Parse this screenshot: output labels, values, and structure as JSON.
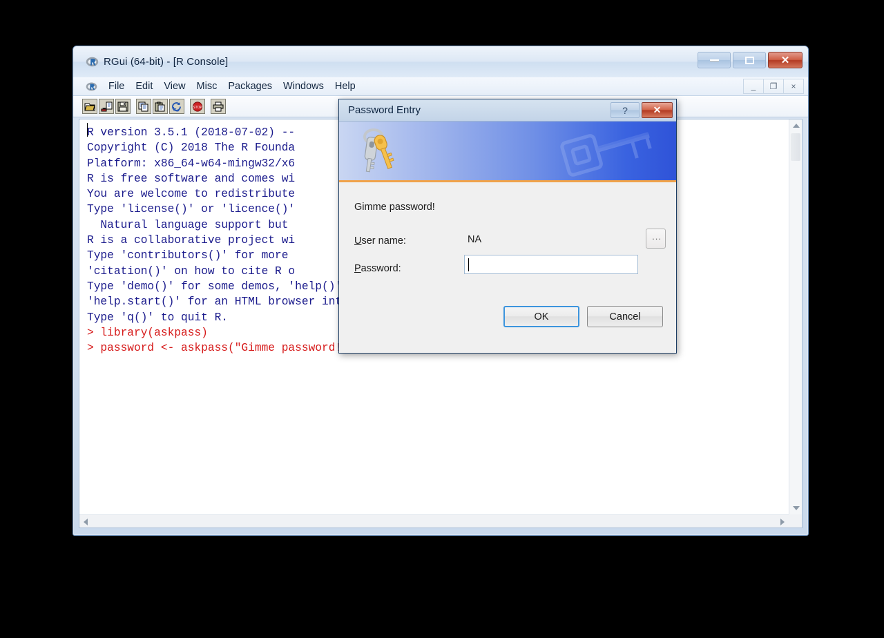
{
  "window": {
    "title": "RGui (64-bit) - [R Console]",
    "logo_icon": "r-logo-icon",
    "buttons": {
      "minimize": {
        "label": "–",
        "icon": "minimize-icon"
      },
      "maximize": {
        "label": "□",
        "icon": "maximize-icon"
      },
      "close": {
        "label": "✕",
        "icon": "close-icon"
      }
    },
    "mdi_buttons": {
      "minimize": "_",
      "restore": "❐",
      "close": "×"
    }
  },
  "menubar": {
    "items": [
      {
        "label": "File"
      },
      {
        "label": "Edit"
      },
      {
        "label": "View"
      },
      {
        "label": "Misc"
      },
      {
        "label": "Packages"
      },
      {
        "label": "Windows"
      },
      {
        "label": "Help"
      }
    ]
  },
  "toolbar": {
    "buttons": [
      {
        "name": "open-script-icon"
      },
      {
        "name": "load-workspace-icon"
      },
      {
        "name": "save-workspace-icon"
      },
      {
        "name": "copy-icon"
      },
      {
        "name": "paste-icon"
      },
      {
        "name": "copy-paste-icon"
      },
      {
        "name": "stop-icon"
      },
      {
        "name": "print-icon"
      }
    ]
  },
  "console": {
    "text_color": "#1a1a8c",
    "command_color": "#d61a1a",
    "lines": [
      {
        "text": "",
        "type": "out"
      },
      {
        "text": "R version 3.5.1 (2018-07-02) --",
        "type": "out"
      },
      {
        "text": "Copyright (C) 2018 The R Founda",
        "type": "out"
      },
      {
        "text": "Platform: x86_64-w64-mingw32/x6",
        "type": "out"
      },
      {
        "text": "",
        "type": "out"
      },
      {
        "text": "R is free software and comes wi",
        "type": "out"
      },
      {
        "text": "You are welcome to redistribute",
        "type": "out"
      },
      {
        "text": "Type 'license()' or 'licence()'",
        "type": "out"
      },
      {
        "text": "",
        "type": "out"
      },
      {
        "text": "  Natural language support but ",
        "type": "out"
      },
      {
        "text": "",
        "type": "out"
      },
      {
        "text": "R is a collaborative project wi",
        "type": "out"
      },
      {
        "text": "Type 'contributors()' for more ",
        "type": "out"
      },
      {
        "text": "'citation()' on how to cite R o",
        "type": "out"
      },
      {
        "text": "",
        "type": "out"
      },
      {
        "text": "Type 'demo()' for some demos, 'help()' for on-line help, or",
        "type": "out"
      },
      {
        "text": "'help.start()' for an HTML browser interface to help.",
        "type": "out"
      },
      {
        "text": "Type 'q()' to quit R.",
        "type": "out"
      },
      {
        "text": "",
        "type": "out"
      },
      {
        "text": "> library(askpass)",
        "type": "cmd"
      },
      {
        "text": "> password <- askpass(\"Gimme password!\")",
        "type": "cmd"
      }
    ]
  },
  "dialog": {
    "title": "Password Entry",
    "help_button": "?",
    "close_button": "✕",
    "banner": {
      "icon": "keys-icon",
      "watermark": "key-watermark-icon",
      "accent_color": "#f0a24a",
      "gradient_from": "#c9d6f2",
      "gradient_to": "#2f53d8"
    },
    "prompt": "Gimme password!",
    "username": {
      "label_prefix": "U",
      "label_rest": "ser name:",
      "value": "NA"
    },
    "browse_button": "...",
    "password": {
      "label_prefix": "P",
      "label_rest": "assword:",
      "value": "",
      "placeholder": ""
    },
    "ok_button": "OK",
    "cancel_button": "Cancel"
  }
}
